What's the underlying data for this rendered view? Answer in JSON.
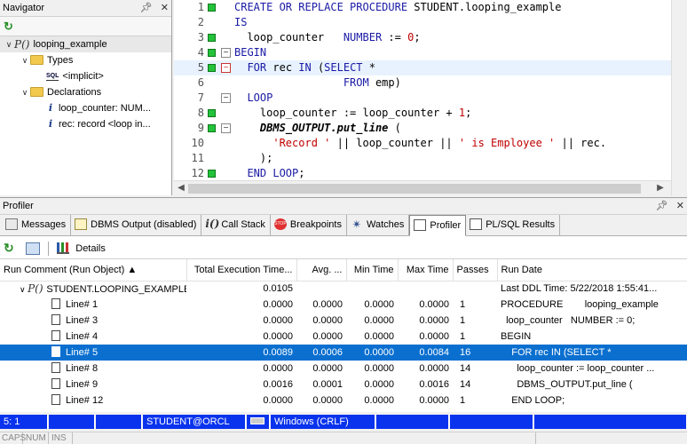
{
  "navigator": {
    "title": "Navigator",
    "tree": [
      {
        "label": "looping_example",
        "icon": "procedure-icon",
        "level": 0,
        "expanded": true
      },
      {
        "label": "Types",
        "icon": "folder-icon",
        "level": 1,
        "expanded": true
      },
      {
        "label": "<implicit>",
        "icon": "sql-icon",
        "level": 2
      },
      {
        "label": "Declarations",
        "icon": "folder-icon",
        "level": 1,
        "expanded": true
      },
      {
        "label": "loop_counter: NUM...",
        "icon": "variable-icon",
        "level": 2
      },
      {
        "label": "rec: record <loop in...",
        "icon": "variable-icon",
        "level": 2
      }
    ]
  },
  "editor": {
    "lines": [
      {
        "n": "1",
        "bp": true,
        "fold": "",
        "html_parts": [
          [
            "kw",
            "CREATE OR REPLACE PROCEDURE "
          ],
          [
            "",
            "STUDENT.looping_example"
          ]
        ]
      },
      {
        "n": "2",
        "bp": false,
        "fold": "",
        "html_parts": [
          [
            "kw",
            "IS"
          ]
        ]
      },
      {
        "n": "3",
        "bp": true,
        "fold": "",
        "html_parts": [
          [
            "",
            "  loop_counter   "
          ],
          [
            "kw",
            "NUMBER"
          ],
          [
            "",
            " := "
          ],
          [
            "num",
            "0"
          ],
          [
            "",
            ";"
          ]
        ]
      },
      {
        "n": "4",
        "bp": true,
        "fold": "minus",
        "html_parts": [
          [
            "kw",
            "BEGIN"
          ]
        ]
      },
      {
        "n": "5",
        "bp": true,
        "fold": "minus-red",
        "current": true,
        "html_parts": [
          [
            "",
            "  "
          ],
          [
            "kw",
            "FOR"
          ],
          [
            "",
            " rec "
          ],
          [
            "kw",
            "IN"
          ],
          [
            "",
            " ("
          ],
          [
            "kw",
            "SELECT"
          ],
          [
            "",
            " *"
          ]
        ]
      },
      {
        "n": "6",
        "bp": false,
        "fold": "",
        "html_parts": [
          [
            "",
            "                 "
          ],
          [
            "kw",
            "FROM"
          ],
          [
            "",
            " emp)"
          ]
        ]
      },
      {
        "n": "7",
        "bp": false,
        "fold": "minus",
        "html_parts": [
          [
            "",
            "  "
          ],
          [
            "kw",
            "LOOP"
          ]
        ]
      },
      {
        "n": "8",
        "bp": true,
        "fold": "",
        "html_parts": [
          [
            "",
            "    loop_counter := loop_counter + "
          ],
          [
            "num",
            "1"
          ],
          [
            "",
            ";"
          ]
        ]
      },
      {
        "n": "9",
        "bp": true,
        "fold": "minus",
        "html_parts": [
          [
            "",
            "    "
          ],
          [
            "fn",
            "DBMS_OUTPUT.put_line"
          ],
          [
            "",
            " ("
          ]
        ]
      },
      {
        "n": "10",
        "bp": false,
        "fold": "",
        "html_parts": [
          [
            "",
            "      "
          ],
          [
            "str",
            "'Record '"
          ],
          [
            "",
            " || loop_counter || "
          ],
          [
            "str",
            "' is Employee '"
          ],
          [
            "",
            " || rec."
          ]
        ]
      },
      {
        "n": "11",
        "bp": false,
        "fold": "",
        "html_parts": [
          [
            "",
            "    );"
          ]
        ]
      },
      {
        "n": "12",
        "bp": true,
        "fold": "",
        "html_parts": [
          [
            "",
            "  "
          ],
          [
            "kw",
            "END LOOP"
          ],
          [
            "",
            ";"
          ]
        ]
      }
    ]
  },
  "profiler": {
    "title": "Profiler",
    "tabs": [
      {
        "label": "Messages",
        "icon": "messages-icon",
        "active": false
      },
      {
        "label": "DBMS Output (disabled)",
        "icon": "dbms-output-icon",
        "active": false
      },
      {
        "label": "Call Stack",
        "icon": "call-stack-icon",
        "active": false
      },
      {
        "label": "Breakpoints",
        "icon": "breakpoints-icon",
        "active": false
      },
      {
        "label": "Watches",
        "icon": "watches-icon",
        "active": false
      },
      {
        "label": "Profiler",
        "icon": "profiler-icon",
        "active": true
      },
      {
        "label": "PL/SQL Results",
        "icon": "plsql-results-icon",
        "active": false
      }
    ],
    "toolbar": {
      "details_label": "Details"
    },
    "columns": [
      "Run Comment (Run Object)",
      "Total Execution Time...",
      "Avg. ...",
      "Min Time",
      "Max Time",
      "Passes",
      "Run Date"
    ],
    "root": {
      "object": "STUDENT.LOOPING_EXAMPLE",
      "total": "0.0105",
      "run_date": "Last DDL Time: 5/22/2018 1:55:41..."
    },
    "rows": [
      {
        "line": "Line# 1",
        "total": "0.0000",
        "avg": "0.0000",
        "min": "0.0000",
        "max": "0.0000",
        "passes": "1",
        "text": "PROCEDURE        looping_example",
        "selected": false
      },
      {
        "line": "Line# 3",
        "total": "0.0000",
        "avg": "0.0000",
        "min": "0.0000",
        "max": "0.0000",
        "passes": "1",
        "text": "  loop_counter   NUMBER := 0;",
        "selected": false
      },
      {
        "line": "Line# 4",
        "total": "0.0000",
        "avg": "0.0000",
        "min": "0.0000",
        "max": "0.0000",
        "passes": "1",
        "text": "BEGIN",
        "selected": false
      },
      {
        "line": "Line# 5",
        "total": "0.0089",
        "avg": "0.0006",
        "min": "0.0000",
        "max": "0.0084",
        "passes": "16",
        "text": "    FOR rec IN (SELECT *",
        "selected": true
      },
      {
        "line": "Line# 8",
        "total": "0.0000",
        "avg": "0.0000",
        "min": "0.0000",
        "max": "0.0000",
        "passes": "14",
        "text": "      loop_counter := loop_counter ...",
        "selected": false
      },
      {
        "line": "Line# 9",
        "total": "0.0016",
        "avg": "0.0001",
        "min": "0.0000",
        "max": "0.0016",
        "passes": "14",
        "text": "      DBMS_OUTPUT.put_line (",
        "selected": false
      },
      {
        "line": "Line# 12",
        "total": "0.0000",
        "avg": "0.0000",
        "min": "0.0000",
        "max": "0.0000",
        "passes": "1",
        "text": "    END LOOP;",
        "selected": false
      }
    ]
  },
  "statusbar": {
    "position": "5:  1",
    "connection": "STUDENT@ORCL",
    "line_ending": "Windows (CRLF)"
  },
  "footer": {
    "caps": "CAPS",
    "num": "NUM",
    "ins": "INS"
  }
}
